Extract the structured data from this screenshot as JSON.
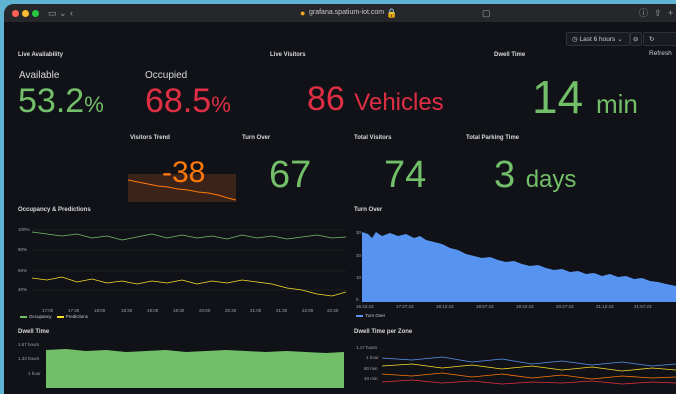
{
  "browser": {
    "url": "grafana.spatium-iot.com"
  },
  "toolbar": {
    "time_range": "Last 6 hours",
    "refresh": "Refresh"
  },
  "colors": {
    "green": "#73bf69",
    "red": "#e02f44",
    "orange": "#ff780a",
    "blue": "#5794f2",
    "yellow": "#fade2a"
  },
  "panels": {
    "live_availability": {
      "title": "Live Availability",
      "available_label": "Available",
      "available_value": "53.2",
      "available_unit": "%",
      "occupied_label": "Occupied",
      "occupied_value": "68.5",
      "occupied_unit": "%"
    },
    "live_visitors": {
      "title": "Live Visitors",
      "value": "86",
      "unit": "Vehicles"
    },
    "dwell_time": {
      "title": "Dwell Time",
      "value": "14",
      "unit": "min"
    },
    "visitors_trend": {
      "title": "Visitors Trend",
      "value": "-38"
    },
    "turn_over_stat": {
      "title": "Turn Over",
      "value": "67"
    },
    "total_visitors": {
      "title": "Total Visitors",
      "value": "74"
    },
    "total_parking_time": {
      "title": "Total Parking Time",
      "value": "3",
      "unit": "days"
    },
    "occupancy": {
      "title": "Occupancy & Predictions",
      "y_ticks": [
        "100%",
        "80%",
        "60%",
        "40%"
      ],
      "x_ticks": [
        "17:00",
        "17:30",
        "18:00",
        "18:30",
        "19:00",
        "19:30",
        "20:00",
        "20:30",
        "21:00",
        "21:30",
        "22:00",
        "22:30"
      ],
      "legend": [
        "Occupancy",
        "Predictions"
      ]
    },
    "turn_over_chart": {
      "title": "Turn Over",
      "y_ticks": [
        "30",
        "20",
        "10",
        "0"
      ],
      "x_ticks": [
        "16:42:23",
        "17:27:23",
        "18:12:23",
        "18:57:23",
        "19:42:23",
        "20:27:23",
        "21:12:23",
        "21:57:23"
      ],
      "legend": [
        "Turn Over"
      ]
    },
    "dwell_time_chart": {
      "title": "Dwell Time",
      "y_ticks": [
        "1.67 hours",
        "1.33 hours",
        "1 hour"
      ]
    },
    "dwell_zone": {
      "title": "Dwell Time per Zone",
      "y_ticks": [
        "1.17 hours",
        "1 hour",
        "50 min",
        "40 min"
      ]
    }
  }
}
